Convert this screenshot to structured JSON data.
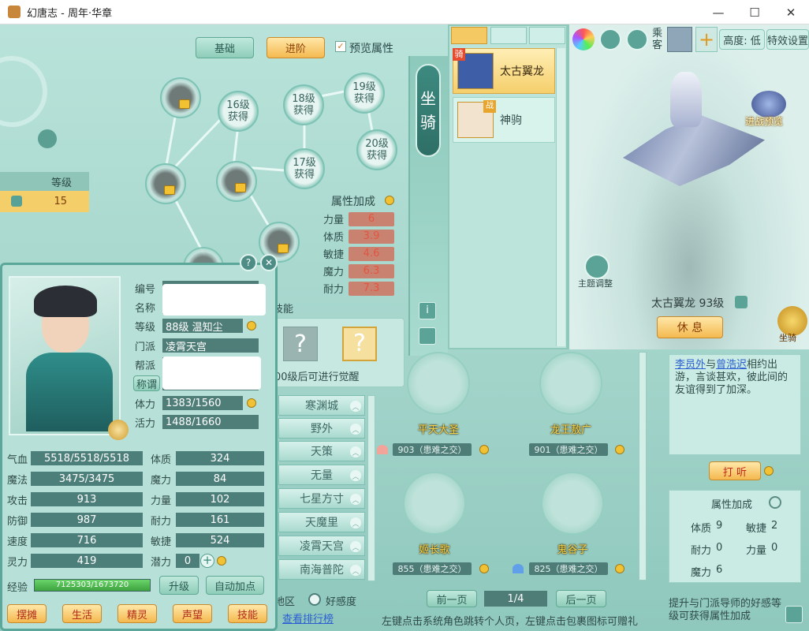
{
  "window": {
    "title": "幻唐志 - 周年·华章",
    "min": "—",
    "max": "☐",
    "close": "✕"
  },
  "top_tabs": {
    "basic": "基础",
    "advanced": "进阶",
    "preview_label": "预览属性",
    "preview_checked": true
  },
  "level_col": {
    "header": "等级",
    "value": "15"
  },
  "skill_nodes": [
    {
      "label": "16级\n获得"
    },
    {
      "label": "18级\n获得"
    },
    {
      "label": "19级\n获得"
    },
    {
      "label": "17级\n获得"
    },
    {
      "label": "20级\n获得"
    }
  ],
  "attr_bonus": {
    "title": "属性加成",
    "rows": [
      {
        "label": "力量",
        "value": "6"
      },
      {
        "label": "体质",
        "value": "3.9"
      },
      {
        "label": "敏捷",
        "value": "4.6"
      },
      {
        "label": "魔力",
        "value": "6.3"
      },
      {
        "label": "耐力",
        "value": "7.3"
      }
    ]
  },
  "awaken": {
    "skill_label": "技能",
    "note": "00级后可进行觉醒"
  },
  "mount_side": {
    "label": "坐\n骑"
  },
  "mount_list": [
    {
      "name": "太古翼龙",
      "tag": "骑"
    },
    {
      "name": "神驹",
      "tag": "战"
    }
  ],
  "mount_view": {
    "passenger_label": "乘客",
    "height_label": "高度: 低",
    "effect_label": "特效设置",
    "battle_preview": "进战预览",
    "theme_adjust": "主题调整",
    "mount_name": "太古翼龙 93级",
    "rest_button": "休 息",
    "mount_button": "坐骑"
  },
  "char_card": {
    "fields": [
      {
        "label": "编号",
        "value": ""
      },
      {
        "label": "名称",
        "value": ""
      },
      {
        "label": "等级",
        "value": "88级   温知尘"
      },
      {
        "label": "门派",
        "value": "凌霄天宫"
      },
      {
        "label": "帮派",
        "value": ""
      },
      {
        "label": "称谓",
        "value": ""
      },
      {
        "label": "体力",
        "value": "1383/1560"
      },
      {
        "label": "活力",
        "value": "1488/1660"
      }
    ],
    "stats_left": [
      {
        "label": "气血",
        "value": "5518/5518/5518"
      },
      {
        "label": "魔法",
        "value": "3475/3475"
      },
      {
        "label": "攻击",
        "value": "913"
      },
      {
        "label": "防御",
        "value": "987"
      },
      {
        "label": "速度",
        "value": "716"
      },
      {
        "label": "灵力",
        "value": "419"
      }
    ],
    "stats_right": [
      {
        "label": "体质",
        "value": "324"
      },
      {
        "label": "魔力",
        "value": "84"
      },
      {
        "label": "力量",
        "value": "102"
      },
      {
        "label": "耐力",
        "value": "161"
      },
      {
        "label": "敏捷",
        "value": "524"
      },
      {
        "label": "潜力",
        "value": "0"
      }
    ],
    "exp_label": "经验",
    "exp_value": "7125303/1673720",
    "upgrade": "升级",
    "auto_add": "自动加点",
    "bottom_buttons": [
      "摆摊",
      "生活",
      "精灵",
      "声望",
      "技能"
    ]
  },
  "nav_list": [
    "寒渊城",
    "野外",
    "天策",
    "无量",
    "七星方寸",
    "天魔里",
    "凌霄天宫",
    "南海普陀"
  ],
  "region": {
    "label": "地区",
    "favor": "好感度",
    "rank_link": "查看排行榜"
  },
  "npcs": [
    {
      "name": "平天大圣",
      "relation": "903（患难之交）"
    },
    {
      "name": "龙王敖广",
      "relation": "901（患难之交）"
    },
    {
      "name": "姬长歌",
      "relation": "855（患难之交）"
    },
    {
      "name": "鬼谷子",
      "relation": "825（患难之交）"
    }
  ],
  "pager": {
    "prev": "前一页",
    "page": "1/4",
    "next": "后一页"
  },
  "bottom_hint": "左键点击系统角色跳转个人页，左键点击包裹图标可赠礼",
  "story": {
    "name1": "李员外",
    "mid": "与",
    "name2": "曾浩迟",
    "rest": "相约出游，言谈甚欢，彼此间的友谊得到了加深。",
    "listen": "打 听"
  },
  "favor_bonus": {
    "title": "属性加成",
    "rows": [
      {
        "a_label": "体质",
        "a_val": "9",
        "b_label": "敏捷",
        "b_val": "2"
      },
      {
        "a_label": "耐力",
        "a_val": "0",
        "b_label": "力量",
        "b_val": "0"
      },
      {
        "a_label": "魔力",
        "a_val": "6",
        "b_label": "",
        "b_val": ""
      }
    ],
    "hint": "提升与门派导师的好感等级可获得属性加成"
  }
}
